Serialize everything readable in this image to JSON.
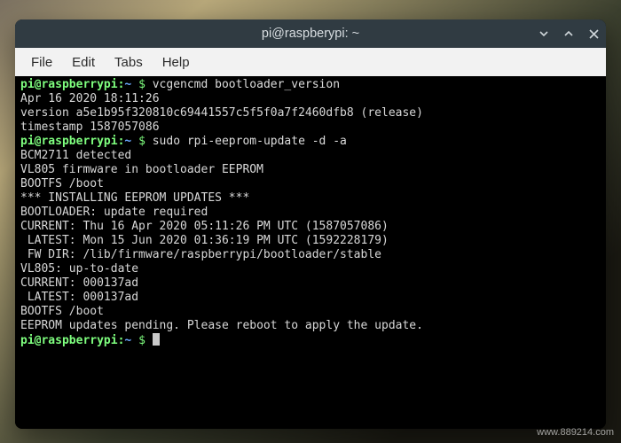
{
  "window": {
    "title": "pi@raspberypi: ~"
  },
  "menubar": {
    "file": "File",
    "edit": "Edit",
    "tabs": "Tabs",
    "help": "Help"
  },
  "prompt": {
    "user_host": "pi@raspberrypi",
    "path": "~",
    "symbol": "$"
  },
  "commands": {
    "cmd1": "vcgencmd bootloader_version",
    "cmd2": "sudo rpi-eeprom-update -d -a"
  },
  "output": {
    "o1": "Apr 16 2020 18:11:26",
    "o2": "version a5e1b95f320810c69441557c5f5f0a7f2460dfb8 (release)",
    "o3": "timestamp 1587057086",
    "o4": "BCM2711 detected",
    "o5": "VL805 firmware in bootloader EEPROM",
    "o6": "BOOTFS /boot",
    "o7": "*** INSTALLING EEPROM UPDATES ***",
    "o8": "BOOTLOADER: update required",
    "o9": "CURRENT: Thu 16 Apr 2020 05:11:26 PM UTC (1587057086)",
    "o10": " LATEST: Mon 15 Jun 2020 01:36:19 PM UTC (1592228179)",
    "o11": " FW DIR: /lib/firmware/raspberrypi/bootloader/stable",
    "o12": "VL805: up-to-date",
    "o13": "CURRENT: 000137ad",
    "o14": " LATEST: 000137ad",
    "o15": "BOOTFS /boot",
    "o16": "EEPROM updates pending. Please reboot to apply the update."
  },
  "watermark": "www.889214.com"
}
